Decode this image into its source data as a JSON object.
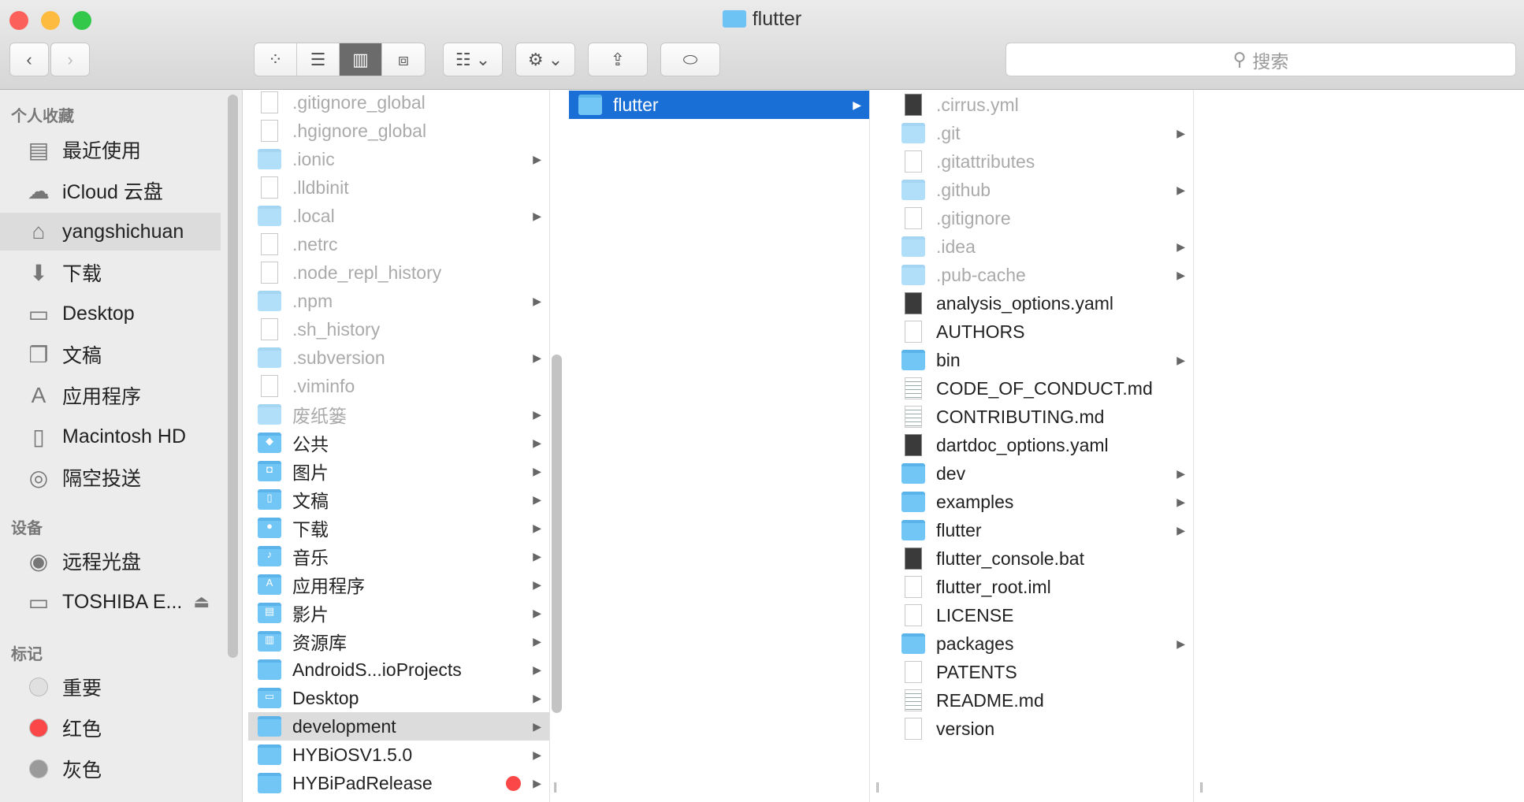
{
  "window": {
    "title": "flutter"
  },
  "toolbar": {
    "back": "‹",
    "forward": "›",
    "search_placeholder": "搜索"
  },
  "colors": {
    "accent": "#1a6fd7",
    "folder": "#72c6f5",
    "red": "#fb4747"
  },
  "sidebar": {
    "favorites_header": "个人收藏",
    "favorites": [
      {
        "label": "最近使用",
        "icon": "recents-icon",
        "glyph": "▤"
      },
      {
        "label": "iCloud 云盘",
        "icon": "cloud-icon",
        "glyph": "☁"
      },
      {
        "label": "yangshichuan",
        "icon": "home-icon",
        "glyph": "⌂",
        "selected": true
      },
      {
        "label": "下载",
        "icon": "download-icon",
        "glyph": "⬇"
      },
      {
        "label": "Desktop",
        "icon": "desktop-icon",
        "glyph": "▭"
      },
      {
        "label": "文稿",
        "icon": "documents-icon",
        "glyph": "❐"
      },
      {
        "label": "应用程序",
        "icon": "applications-icon",
        "glyph": "A"
      },
      {
        "label": "Macintosh HD",
        "icon": "disk-icon",
        "glyph": "▯"
      },
      {
        "label": "隔空投送",
        "icon": "airdrop-icon",
        "glyph": "◎"
      }
    ],
    "devices_header": "设备",
    "devices": [
      {
        "label": "远程光盘",
        "icon": "optical-disc-icon",
        "glyph": "◉"
      },
      {
        "label": "TOSHIBA E...",
        "icon": "external-drive-icon",
        "glyph": "▭",
        "eject": "⏏"
      }
    ],
    "tags_header": "标记",
    "tags": [
      {
        "label": "重要",
        "color": "#e0e0e0"
      },
      {
        "label": "红色",
        "color": "#fb4747"
      },
      {
        "label": "灰色",
        "color": "#9a9a9a"
      }
    ]
  },
  "columns": [
    [
      {
        "name": ".gitignore_global",
        "type": "file",
        "dim": true
      },
      {
        "name": ".hgignore_global",
        "type": "file",
        "dim": true
      },
      {
        "name": ".ionic",
        "type": "folder",
        "dim": true,
        "arrow": true
      },
      {
        "name": ".lldbinit",
        "type": "file",
        "dim": true
      },
      {
        "name": ".local",
        "type": "folder",
        "dim": true,
        "arrow": true
      },
      {
        "name": ".netrc",
        "type": "file",
        "dim": true
      },
      {
        "name": ".node_repl_history",
        "type": "file",
        "dim": true
      },
      {
        "name": ".npm",
        "type": "folder",
        "dim": true,
        "arrow": true
      },
      {
        "name": ".sh_history",
        "type": "file",
        "dim": true
      },
      {
        "name": ".subversion",
        "type": "folder",
        "dim": true,
        "arrow": true
      },
      {
        "name": ".viminfo",
        "type": "file",
        "dim": true
      },
      {
        "name": "废纸篓",
        "type": "folder",
        "dim": true,
        "arrow": true
      },
      {
        "name": "公共",
        "type": "folder",
        "arrow": true,
        "sym": "◆"
      },
      {
        "name": "图片",
        "type": "folder",
        "arrow": true,
        "sym": "◘"
      },
      {
        "name": "文稿",
        "type": "folder",
        "arrow": true,
        "sym": "▯"
      },
      {
        "name": "下载",
        "type": "folder",
        "arrow": true,
        "sym": "●"
      },
      {
        "name": "音乐",
        "type": "folder",
        "arrow": true,
        "sym": "♪"
      },
      {
        "name": "应用程序",
        "type": "folder",
        "arrow": true,
        "sym": "A"
      },
      {
        "name": "影片",
        "type": "folder",
        "arrow": true,
        "sym": "▤"
      },
      {
        "name": "资源库",
        "type": "folder",
        "arrow": true,
        "sym": "▥"
      },
      {
        "name": "AndroidS...ioProjects",
        "type": "folder",
        "arrow": true
      },
      {
        "name": "Desktop",
        "type": "folder",
        "arrow": true,
        "sym": "▭"
      },
      {
        "name": "development",
        "type": "folder",
        "arrow": true,
        "state": "gray"
      },
      {
        "name": "HYBiOSV1.5.0",
        "type": "folder",
        "arrow": true
      },
      {
        "name": "HYBiPadRelease",
        "type": "folder",
        "arrow": true,
        "tag": "#fb4747"
      }
    ],
    [
      {
        "name": "flutter",
        "type": "folder",
        "arrow": true,
        "state": "sel"
      }
    ],
    [
      {
        "name": ".cirrus.yml",
        "type": "dark",
        "dim": true
      },
      {
        "name": ".git",
        "type": "folder",
        "dim": true,
        "arrow": true
      },
      {
        "name": ".gitattributes",
        "type": "file",
        "dim": true
      },
      {
        "name": ".github",
        "type": "folder",
        "dim": true,
        "arrow": true
      },
      {
        "name": ".gitignore",
        "type": "file",
        "dim": true
      },
      {
        "name": ".idea",
        "type": "folder",
        "dim": true,
        "arrow": true
      },
      {
        "name": ".pub-cache",
        "type": "folder",
        "dim": true,
        "arrow": true
      },
      {
        "name": "analysis_options.yaml",
        "type": "dark"
      },
      {
        "name": "AUTHORS",
        "type": "file"
      },
      {
        "name": "bin",
        "type": "folder",
        "arrow": true
      },
      {
        "name": "CODE_OF_CONDUCT.md",
        "type": "md"
      },
      {
        "name": "CONTRIBUTING.md",
        "type": "md"
      },
      {
        "name": "dartdoc_options.yaml",
        "type": "dark"
      },
      {
        "name": "dev",
        "type": "folder",
        "arrow": true
      },
      {
        "name": "examples",
        "type": "folder",
        "arrow": true
      },
      {
        "name": "flutter",
        "type": "folder",
        "arrow": true
      },
      {
        "name": "flutter_console.bat",
        "type": "dark"
      },
      {
        "name": "flutter_root.iml",
        "type": "file"
      },
      {
        "name": "LICENSE",
        "type": "file"
      },
      {
        "name": "packages",
        "type": "folder",
        "arrow": true
      },
      {
        "name": "PATENTS",
        "type": "file"
      },
      {
        "name": "README.md",
        "type": "md"
      },
      {
        "name": "version",
        "type": "file"
      }
    ]
  ]
}
